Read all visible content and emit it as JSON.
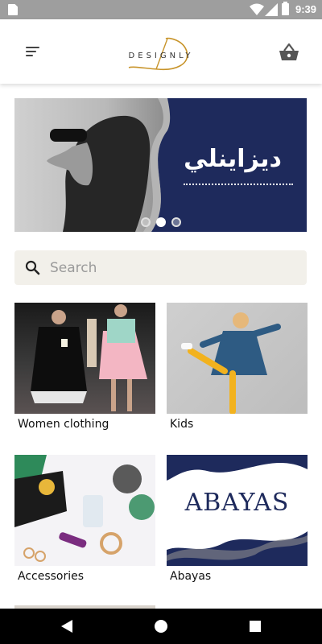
{
  "status_bar": {
    "time": "9:39",
    "icons": [
      "sim-icon",
      "wifi-icon",
      "signal-icon",
      "battery-icon"
    ]
  },
  "header": {
    "logo_text": "DESIGNLY",
    "logo_mark": "D",
    "menu_icon": "menu-icon",
    "cart_icon": "basket-icon"
  },
  "banner": {
    "title": "ديزاينلي",
    "slides_total": 3,
    "active_slide": 2
  },
  "search": {
    "placeholder": "Search",
    "value": ""
  },
  "categories": [
    {
      "label": "Women clothing"
    },
    {
      "label": "Kids"
    },
    {
      "label": "Accessories"
    },
    {
      "label": "Abayas",
      "image_text": "ABAYAS"
    }
  ],
  "colors": {
    "brand_navy": "#1e2a5c",
    "logo_gold": "#c8942a",
    "search_bg": "#f2f0ea",
    "status_bar": "#9e9e9e"
  }
}
